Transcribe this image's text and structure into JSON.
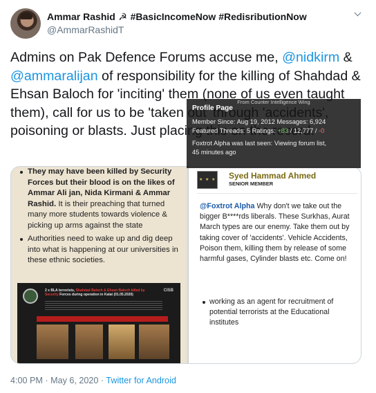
{
  "author": {
    "display_name": "Ammar Rashid",
    "emoji": "☭",
    "hashtags": "#BasicIncomeNow #RedisributionNow",
    "handle": "@AmmarRashidT"
  },
  "tweet": {
    "part1": "Admins on Pak Defence Forums  accuse me, ",
    "mention1": "@nidkirm",
    "part2": " & ",
    "mention2": "@ammaralijan",
    "part3": " of responsibility for the killing of Shahdad & Ehsan Baloch for 'inciting' them (none of us even taught them), call for us to be 'taken out' through 'accidents', poisoning or blasts. Just placing this on the record."
  },
  "media_left": {
    "bullet1_bold": "They may have been killed by Security Forces but their blood is on the likes of Ammar Ali jan, Nida Kirmani & Ammar Rashid.",
    "bullet1_rest": " It is their preaching that turned many more students towards violence & picking up arms against the state",
    "bullet2": "Authorities need to wake up and dig deep into what is happening at our universities in these ethnic societies.",
    "card_head_1": "2 x BLA terrorists, ",
    "card_head_red": "Shahdad Baloch & Ehsan Baloch killed by Security",
    "card_head_2": " Forces during operation in Kalat (01.05.2020)",
    "card_logo": "CISB"
  },
  "media_right": {
    "member_name": "Syed Hammad Ahmed",
    "member_rank": "SENIOR MEMBER",
    "quote_name": "@Foxtrot Alpha",
    "post_text": " Why don't we take out the bigger B****rds liberals. These Surkhas, Aurat March types are our enemy. Take them out by taking cover of 'accidents'. Vehicle Accidents, Poison them, killing them by release of some harmful gases, Cylinder blasts etc. Come on!",
    "lower_bullet": "working as an agent for recruitment of potential terrorists at the Educational institutes"
  },
  "tooltip": {
    "sub": "From Counter Intelligence Wing",
    "title": "Profile Page",
    "member_since": "Member Since: Aug 19, 2012  Messages: 6,924",
    "featured_prefix": "Featured Threads: 5  Ratings: ",
    "ratings_pos": "+83",
    "ratings_mid": " / 12,777 / ",
    "ratings_neg": "-0",
    "last_seen_1": "Foxtrot Alpha was last seen: Viewing forum list,",
    "last_seen_2": "45 minutes ago"
  },
  "footer": {
    "time": "4:00 PM · May 6, 2020 · ",
    "source": "Twitter for Android"
  },
  "colors": {
    "link": "#1b95e0",
    "secondary_text": "#657786",
    "positive": "#7ecf6a",
    "negative": "#ff6b6b"
  },
  "icons": [
    "avatar",
    "hammer-sickle-icon",
    "chevron-down-icon"
  ]
}
